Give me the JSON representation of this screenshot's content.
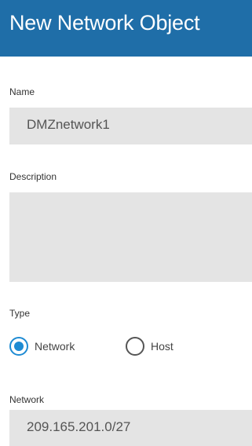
{
  "dialog": {
    "title": "New Network Object"
  },
  "form": {
    "name": {
      "label": "Name",
      "value": "DMZnetwork1"
    },
    "description": {
      "label": "Description",
      "value": ""
    },
    "type": {
      "label": "Type",
      "options": [
        {
          "label": "Network",
          "selected": true
        },
        {
          "label": "Host",
          "selected": false
        }
      ]
    },
    "network": {
      "label": "Network",
      "value": "209.165.201.0/27"
    }
  },
  "colors": {
    "header_bg": "#1f6ea8",
    "accent": "#1e8bd3",
    "field_bg": "#e4e4e4"
  }
}
